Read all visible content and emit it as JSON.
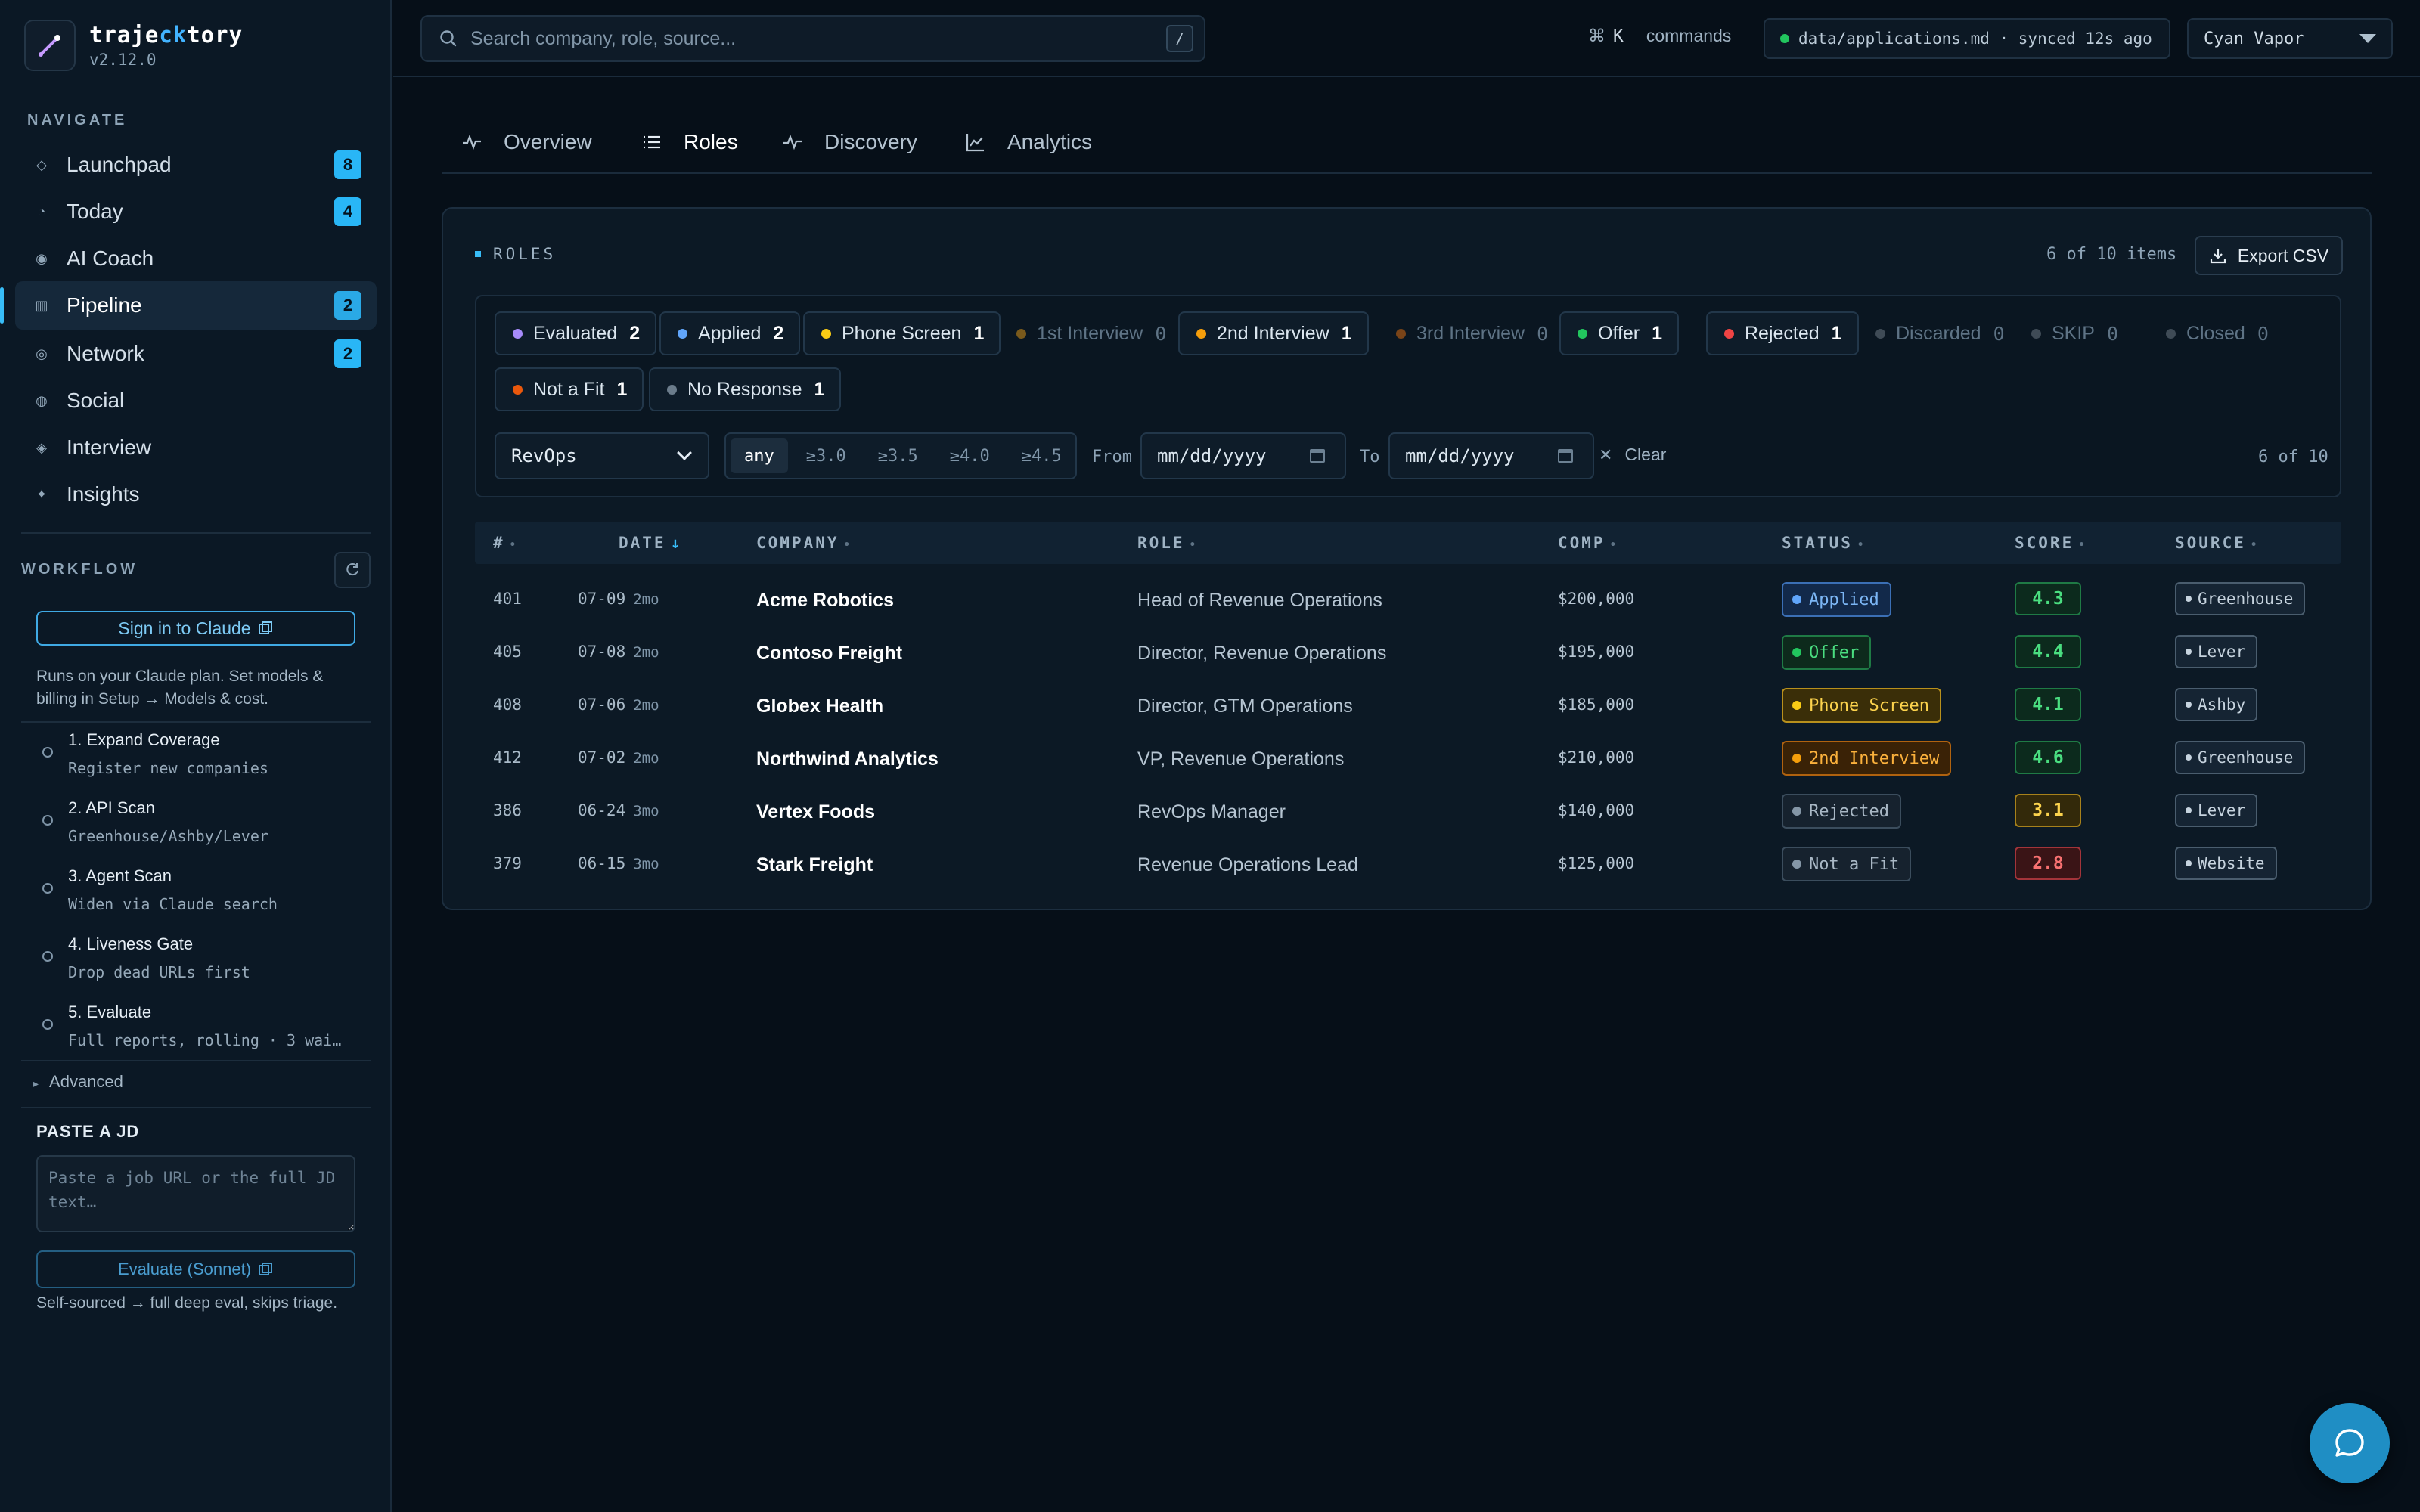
{
  "brand": {
    "name_prefix": "traje",
    "name_accent": "ck",
    "name_suffix": "tory",
    "version": "v2.12.0"
  },
  "sidebar": {
    "navigate_label": "NAVIGATE",
    "items": [
      {
        "label": "Launchpad",
        "icon": "diamond-icon",
        "badge": "8"
      },
      {
        "label": "Today",
        "icon": "clock-icon",
        "badge": "4"
      },
      {
        "label": "AI Coach",
        "icon": "target-icon",
        "badge": ""
      },
      {
        "label": "Pipeline",
        "icon": "grid-icon",
        "badge": "2",
        "active": true
      },
      {
        "label": "Network",
        "icon": "network-icon",
        "badge": "2"
      },
      {
        "label": "Social",
        "icon": "social-icon",
        "badge": ""
      },
      {
        "label": "Interview",
        "icon": "interview-icon",
        "badge": ""
      },
      {
        "label": "Insights",
        "icon": "sparkle-icon",
        "badge": ""
      }
    ],
    "workflow_label": "WORKFLOW",
    "signin_label": "Sign in to Claude",
    "plan_note": "Runs on your Claude plan. Set models & billing in Setup → Models & cost.",
    "steps": [
      {
        "title": "1. Expand Coverage",
        "sub": "Register new companies"
      },
      {
        "title": "2. API Scan",
        "sub": "Greenhouse/Ashby/Lever"
      },
      {
        "title": "3. Agent Scan",
        "sub": "Widen via Claude search"
      },
      {
        "title": "4. Liveness Gate",
        "sub": "Drop dead URLs first"
      },
      {
        "title": "5. Evaluate",
        "sub": "Full reports, rolling · 3 wai…"
      }
    ],
    "advanced_label": "Advanced",
    "paste_label": "PASTE A JD",
    "paste_placeholder": "Paste a job URL or the full JD text…",
    "evaluate_label": "Evaluate (Sonnet)",
    "self_note": "Self-sourced → full deep eval, skips triage."
  },
  "topbar": {
    "search_placeholder": "Search company, role, source...",
    "slash_key": "/",
    "cmd_key": "⌘",
    "cmd_letter": "K",
    "cmd_label": "commands",
    "sync_text": "data/applications.md · synced 12s ago",
    "theme": "Cyan Vapor"
  },
  "tabs": [
    {
      "label": "Overview"
    },
    {
      "label": "Roles",
      "active": true
    },
    {
      "label": "Discovery"
    },
    {
      "label": "Analytics"
    }
  ],
  "card": {
    "title": "ROLES",
    "items_count": "6 of 10 items",
    "export_label": "Export CSV"
  },
  "chips": [
    {
      "label": "Evaluated",
      "count": "2",
      "color": "#a78bfa"
    },
    {
      "label": "Applied",
      "count": "2",
      "color": "#60a5fa"
    },
    {
      "label": "Phone Screen",
      "count": "1",
      "color": "#facc15"
    },
    {
      "label": "1st Interview",
      "count": "0",
      "color": "#7a5a1c"
    },
    {
      "label": "2nd Interview",
      "count": "1",
      "color": "#f59e0b"
    },
    {
      "label": "3rd Interview",
      "count": "0",
      "color": "#7a4418"
    },
    {
      "label": "Offer",
      "count": "1",
      "color": "#22c55e"
    },
    {
      "label": "Rejected",
      "count": "1",
      "color": "#ef4444"
    },
    {
      "label": "Discarded",
      "count": "0",
      "color": "#3f4b56"
    },
    {
      "label": "SKIP",
      "count": "0",
      "color": "#3f4b56"
    },
    {
      "label": "Closed",
      "count": "0",
      "color": "#3f4b56"
    },
    {
      "label": "Not a Fit",
      "count": "1",
      "color": "#ea580c"
    },
    {
      "label": "No Response",
      "count": "1",
      "color": "#6b7c8b"
    }
  ],
  "filters": {
    "category": "RevOps",
    "score_options": [
      "any",
      "≥3.0",
      "≥3.5",
      "≥4.0",
      "≥4.5"
    ],
    "score_selected": "any",
    "from_label": "From",
    "to_label": "To",
    "date_placeholder": "mm/dd/yyyy",
    "clear_label": "Clear",
    "count": "6 of 10"
  },
  "table": {
    "columns": [
      "#",
      "DATE",
      "COMPANY",
      "ROLE",
      "COMP",
      "STATUS",
      "SCORE",
      "SOURCE"
    ],
    "rows": [
      {
        "id": "401",
        "date": "07-09",
        "ago": "2mo",
        "company": "Acme Robotics",
        "role": "Head of Revenue Operations",
        "comp": "$200,000",
        "status": "Applied",
        "score": "4.3",
        "source": "Greenhouse"
      },
      {
        "id": "405",
        "date": "07-08",
        "ago": "2mo",
        "company": "Contoso Freight",
        "role": "Director, Revenue Operations",
        "comp": "$195,000",
        "status": "Offer",
        "score": "4.4",
        "source": "Lever"
      },
      {
        "id": "408",
        "date": "07-06",
        "ago": "2mo",
        "company": "Globex Health",
        "role": "Director, GTM Operations",
        "comp": "$185,000",
        "status": "Phone Screen",
        "score": "4.1",
        "source": "Ashby"
      },
      {
        "id": "412",
        "date": "07-02",
        "ago": "2mo",
        "company": "Northwind Analytics",
        "role": "VP, Revenue Operations",
        "comp": "$210,000",
        "status": "2nd Interview",
        "score": "4.6",
        "source": "Greenhouse"
      },
      {
        "id": "386",
        "date": "06-24",
        "ago": "3mo",
        "company": "Vertex Foods",
        "role": "RevOps Manager",
        "comp": "$140,000",
        "status": "Rejected",
        "score": "3.1",
        "source": "Lever"
      },
      {
        "id": "379",
        "date": "06-15",
        "ago": "3mo",
        "company": "Stark Freight",
        "role": "Revenue Operations Lead",
        "comp": "$125,000",
        "status": "Not a Fit",
        "score": "2.8",
        "source": "Website"
      }
    ]
  },
  "colors": {
    "accent": "#38bdf8",
    "status": {
      "Applied": {
        "fg": "#7cb6f5",
        "bg": "#12294a",
        "border": "#3b6fb5",
        "dot": "#60a5fa"
      },
      "Offer": {
        "fg": "#4ade80",
        "bg": "#0d2a1c",
        "border": "#1f7a45",
        "dot": "#22c55e"
      },
      "Phone Screen": {
        "fg": "#fcd34d",
        "bg": "#3a2e08",
        "border": "#b8901c",
        "dot": "#facc15"
      },
      "2nd Interview": {
        "fg": "#fbb13c",
        "bg": "#3a2206",
        "border": "#b0620f",
        "dot": "#f59e0b"
      },
      "Rejected": {
        "fg": "#a9b8c5",
        "bg": "#16222e",
        "border": "#3b4d5d",
        "dot": "#8496a6"
      },
      "Not a Fit": {
        "fg": "#a9b8c5",
        "bg": "#16222e",
        "border": "#3b4d5d",
        "dot": "#8496a6"
      }
    },
    "score_high": {
      "fg": "#4ade80",
      "bg": "#0c2a1d",
      "border": "#1f7a45"
    },
    "score_mid": {
      "fg": "#fcd34d",
      "bg": "#33290a",
      "border": "#a7811b"
    },
    "score_low": {
      "fg": "#f87171",
      "bg": "#3a1416",
      "border": "#a3343a"
    }
  }
}
